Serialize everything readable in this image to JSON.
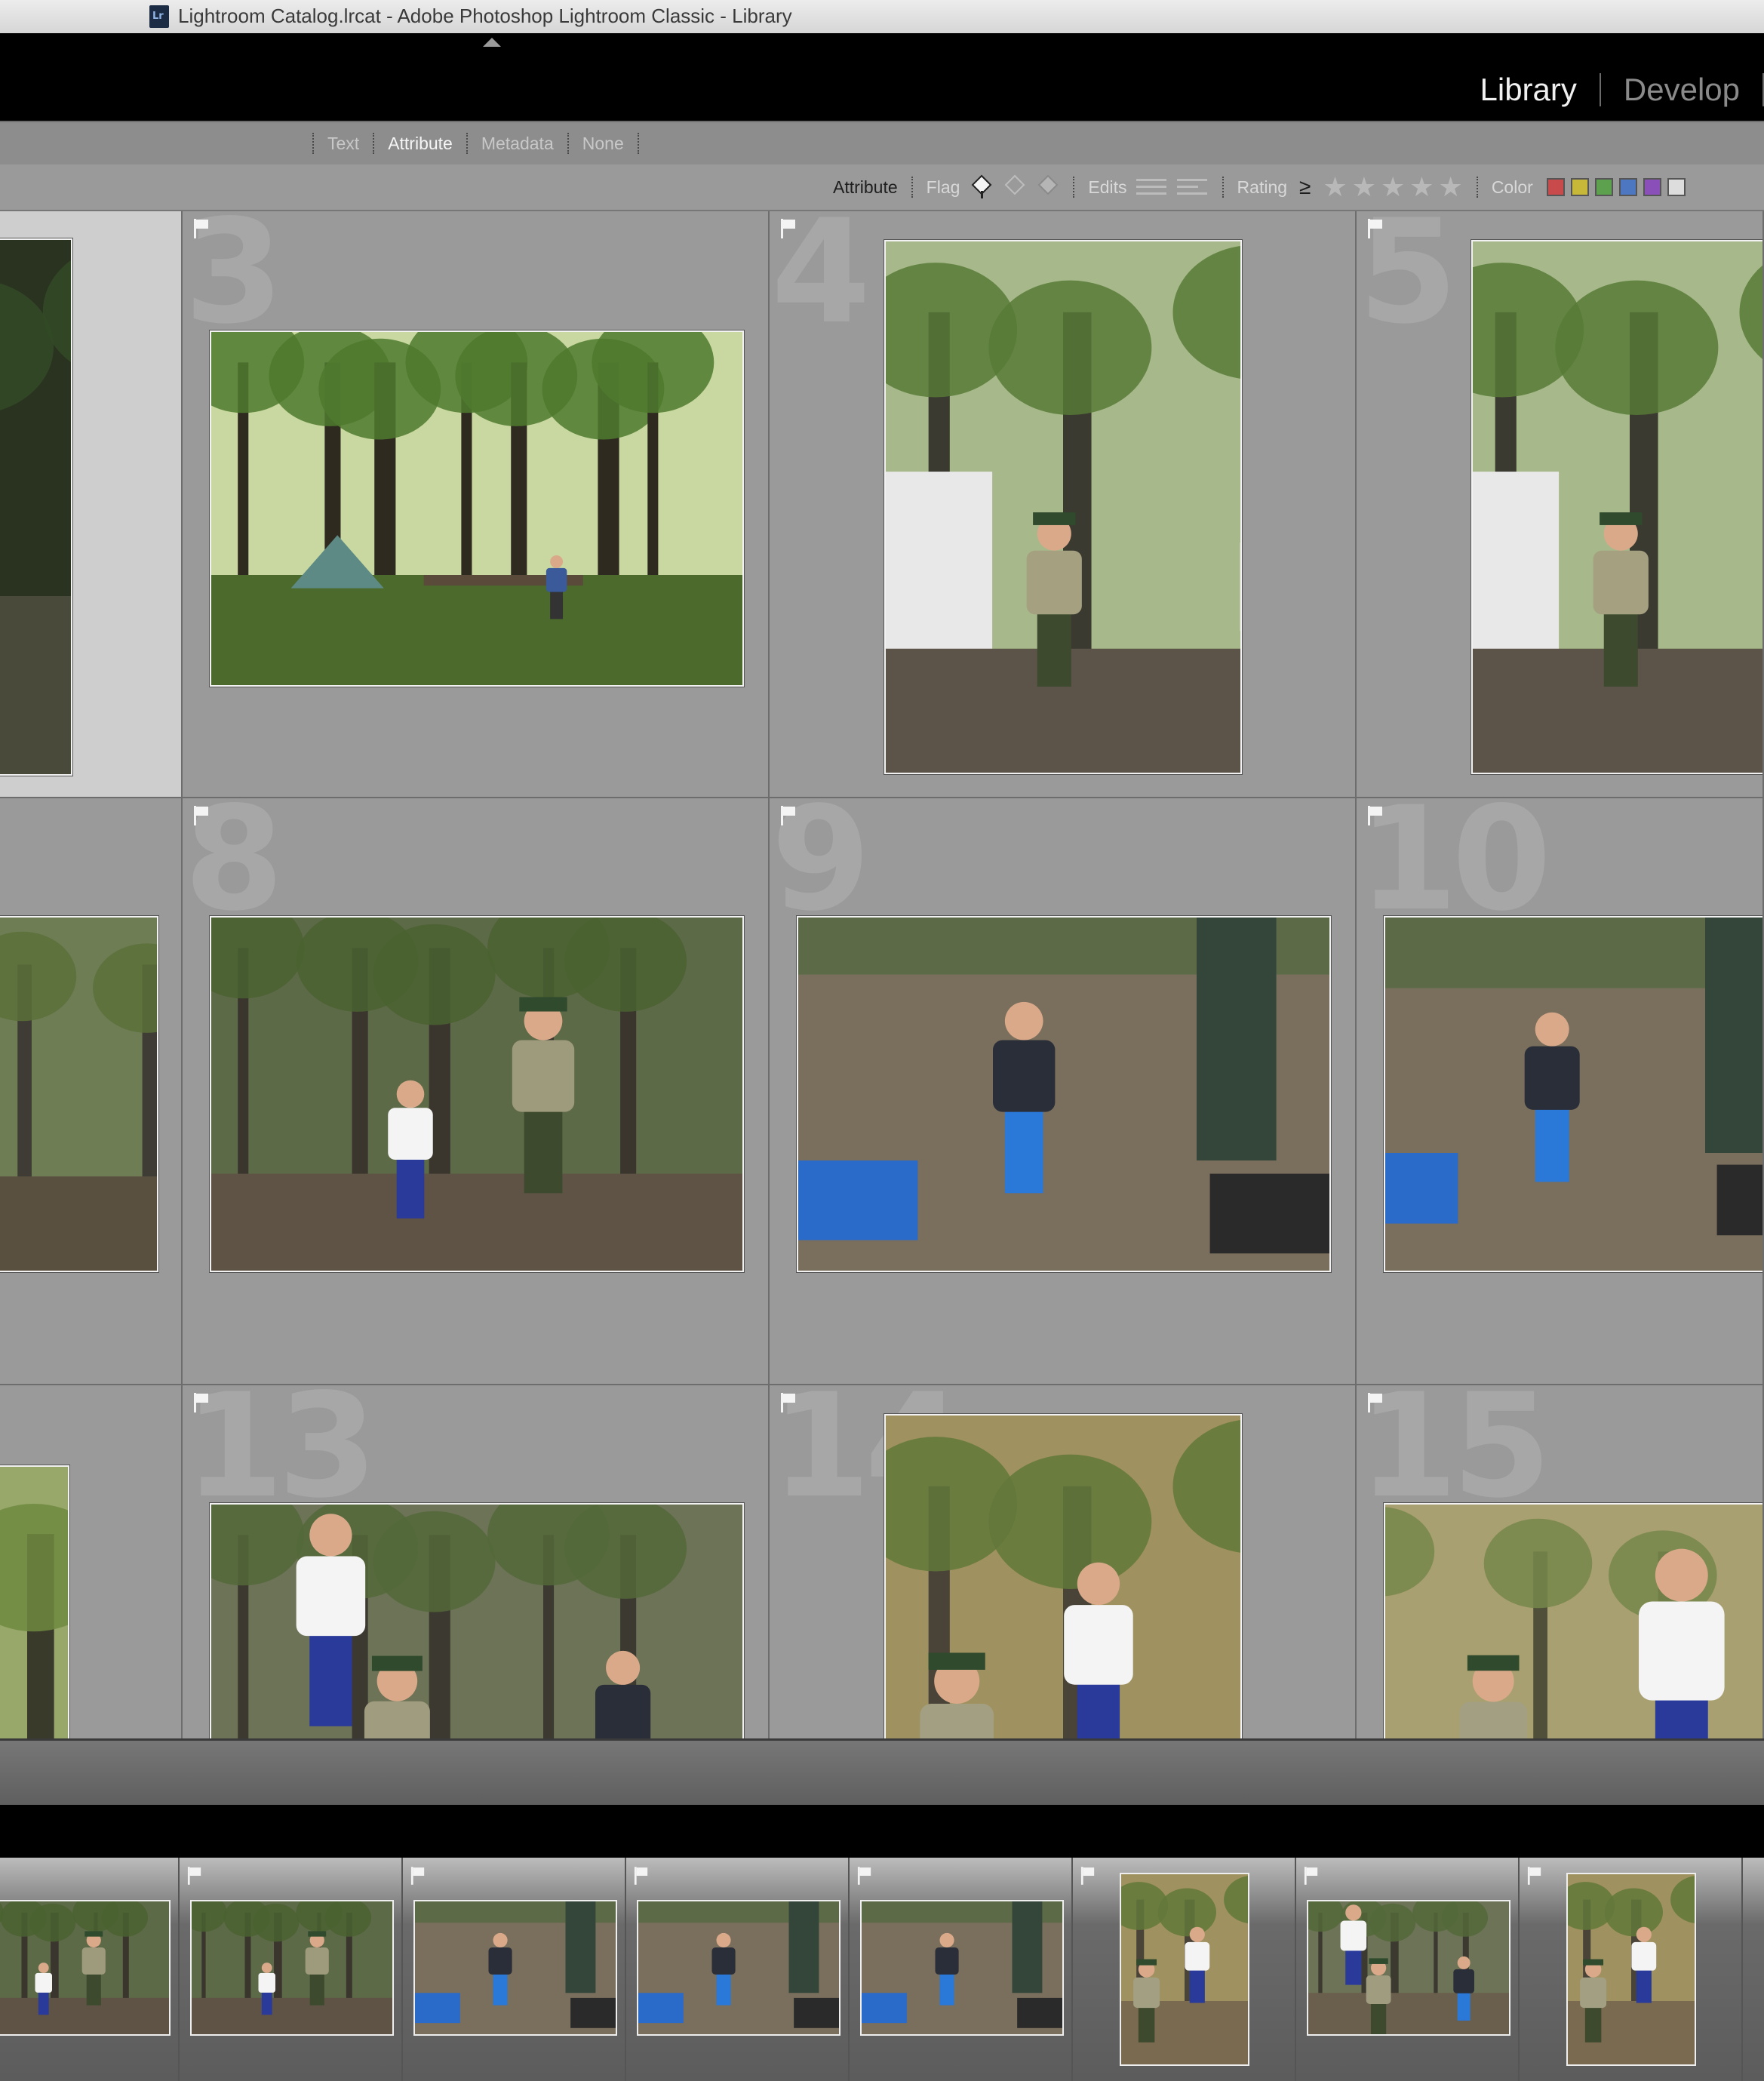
{
  "window": {
    "title": "Lightroom Catalog.lrcat - Adobe Photoshop Lightroom Classic - Library"
  },
  "modules": [
    {
      "label": "Library",
      "active": true
    },
    {
      "label": "Develop",
      "active": false
    }
  ],
  "filter_tabs": [
    {
      "label": "Text",
      "active": false
    },
    {
      "label": "Attribute",
      "active": true
    },
    {
      "label": "Metadata",
      "active": false
    },
    {
      "label": "None",
      "active": false
    }
  ],
  "attribute_bar": {
    "title": "Attribute",
    "flag_label": "Flag",
    "edits_label": "Edits",
    "rating_label": "Rating",
    "rating_operator": "≥",
    "stars": 5,
    "color_label": "Color",
    "color_swatches": [
      "#c94a4a",
      "#c8b83a",
      "#5da04e",
      "#4e77c2",
      "#8a4fb8",
      "#dddddd"
    ]
  },
  "grid": {
    "rows": [
      {
        "cells": [
          {
            "num": "",
            "selected": true,
            "scene": "forest-dark"
          },
          {
            "num": "3",
            "scene": "campsite"
          },
          {
            "num": "4",
            "scene": "ranger-trailer"
          },
          {
            "num": "5",
            "scene": "ranger-trailer"
          }
        ]
      },
      {
        "cells": [
          {
            "num": "",
            "scene": "ranger-trees"
          },
          {
            "num": "8",
            "scene": "girl-ranger"
          },
          {
            "num": "9",
            "scene": "boy-waving"
          },
          {
            "num": "10",
            "scene": "boy-waving"
          }
        ]
      },
      {
        "cells": [
          {
            "num": "",
            "scene": "forest-light"
          },
          {
            "num": "13",
            "scene": "girl-boy-ranger"
          },
          {
            "num": "14",
            "scene": "ranger-girl-tall"
          },
          {
            "num": "15",
            "scene": "ranger-girl-close"
          }
        ]
      }
    ]
  },
  "filmstrip": {
    "thumbs": [
      {
        "scene": "girl-ranger"
      },
      {
        "scene": "girl-ranger"
      },
      {
        "scene": "boy-waving"
      },
      {
        "scene": "boy-waving"
      },
      {
        "scene": "boy-waving"
      },
      {
        "scene": "ranger-girl-tall"
      },
      {
        "scene": "girl-boy-ranger"
      },
      {
        "scene": "ranger-girl-tall"
      }
    ]
  }
}
